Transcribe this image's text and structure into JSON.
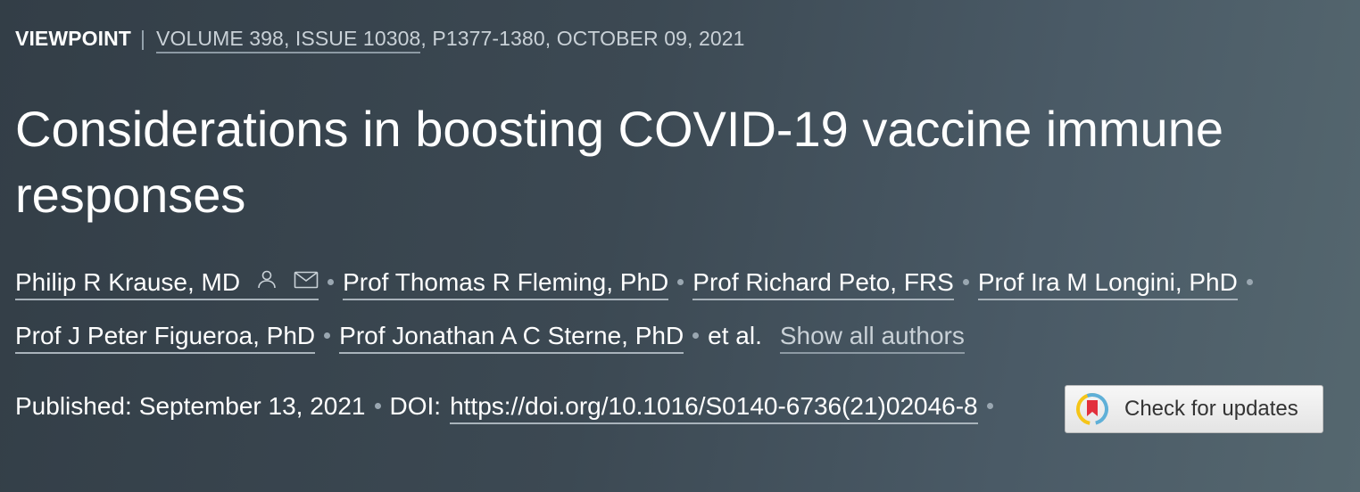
{
  "meta": {
    "article_type": "VIEWPOINT",
    "separator": "|",
    "volume_issue": "VOLUME 398, ISSUE 10308",
    "pages_date": ", P1377-1380, OCTOBER 09, 2021"
  },
  "title": "Considerations in boosting COVID-19 vaccine immune responses",
  "authors": {
    "list": [
      "Philip R Krause, MD",
      "Prof Thomas R Fleming, PhD",
      "Prof Richard Peto, FRS",
      "Prof Ira M Longini, PhD",
      "Prof J Peter Figueroa, PhD",
      "Prof Jonathan A C Sterne, PhD"
    ],
    "et_al": "et al.",
    "show_all": "Show all authors"
  },
  "publication": {
    "published_label": "Published:",
    "published_date": "September 13, 2021",
    "doi_label": "DOI:",
    "doi_url": "https://doi.org/10.1016/S0140-6736(21)02046-8"
  },
  "check_updates": {
    "label": "Check for updates"
  },
  "colors": {
    "background_left": "#333e47",
    "background_right": "#55676f",
    "text": "#ffffff",
    "muted_text": "#c9d1d7"
  },
  "icons": [
    "person-icon",
    "envelope-icon",
    "check-for-updates-logo-icon"
  ]
}
